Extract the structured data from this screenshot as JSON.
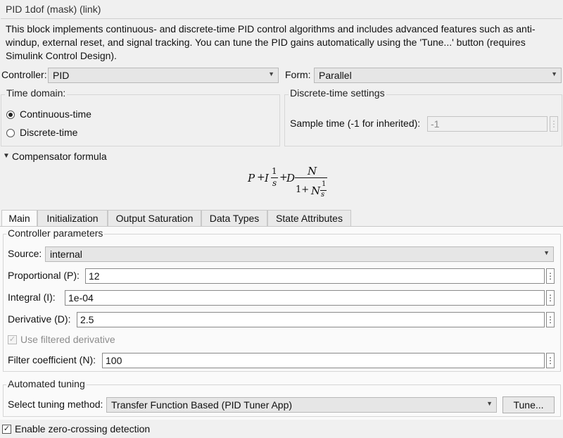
{
  "block": {
    "title": "PID 1dof (mask) (link)",
    "description": "This block implements continuous- and discrete-time PID control algorithms and includes advanced features such as anti-windup, external reset, and signal tracking. You can tune the PID gains automatically using the 'Tune...' button (requires Simulink Control Design)."
  },
  "controller": {
    "label": "Controller:",
    "value": "PID"
  },
  "form": {
    "label": "Form:",
    "value": "Parallel"
  },
  "time_domain": {
    "title": "Time domain:",
    "options": [
      {
        "label": "Continuous-time",
        "selected": true
      },
      {
        "label": "Discrete-time",
        "selected": false
      }
    ]
  },
  "discrete_settings": {
    "title": "Discrete-time settings",
    "sample_time_label": "Sample time (-1 for inherited):",
    "sample_time_value": "-1"
  },
  "compensator": {
    "toggle_label": "Compensator formula",
    "formula": {
      "P": "P",
      "plus": "+",
      "I": "I",
      "one": "1",
      "s": "s",
      "D": "D",
      "N": "N",
      "den": "1+"
    }
  },
  "tabs": [
    {
      "label": "Main",
      "active": true
    },
    {
      "label": "Initialization",
      "active": false
    },
    {
      "label": "Output Saturation",
      "active": false
    },
    {
      "label": "Data Types",
      "active": false
    },
    {
      "label": "State Attributes",
      "active": false
    }
  ],
  "controller_params": {
    "title": "Controller parameters",
    "source_label": "Source:",
    "source_value": "internal",
    "p_label": "Proportional (P):",
    "p_value": "12",
    "i_label": "Integral (I):",
    "i_value": "1e-04",
    "d_label": "Derivative (D):",
    "d_value": "2.5",
    "filtered_label": "Use filtered derivative",
    "filtered_checked": true,
    "n_label": "Filter coefficient (N):",
    "n_value": "100"
  },
  "auto_tuning": {
    "title": "Automated tuning",
    "method_label": "Select tuning method:",
    "method_value": "Transfer Function Based (PID Tuner App)",
    "tune_button": "Tune..."
  },
  "zero_crossing": {
    "label": "Enable zero-crossing detection",
    "checked": true
  },
  "icons": {
    "dropdown": "chevron-down-icon",
    "kebab": "more-vertical-icon",
    "collapse": "triangle-down-icon",
    "check": "check-icon"
  }
}
